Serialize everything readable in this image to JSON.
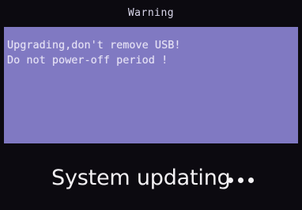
{
  "dialog": {
    "title": "Warning",
    "lines": [
      "Upgrading,don't remove USB!",
      "Do not power-off period !"
    ]
  },
  "status": {
    "text": "System updating",
    "progress_indicator": "•••"
  },
  "colors": {
    "background": "#0c0a10",
    "dialog_panel": "#8079c2",
    "text_light": "#e7e3f6"
  }
}
